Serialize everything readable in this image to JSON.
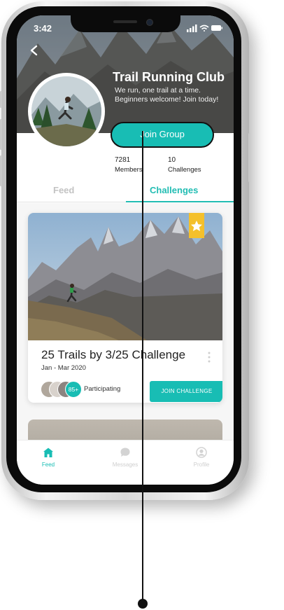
{
  "status_bar": {
    "time": "3:42"
  },
  "group": {
    "name": "Trail Running Club",
    "tagline_1": "We run, one trail at a time.",
    "tagline_2": "Beginners welcome! Join today!",
    "join_label": "Join Group",
    "stats": [
      {
        "value": "7281",
        "label": "Members"
      },
      {
        "value": "10",
        "label": "Challenges"
      }
    ]
  },
  "tabs": [
    {
      "label": "Feed",
      "active": false
    },
    {
      "label": "Challenges",
      "active": true
    }
  ],
  "challenge": {
    "title": "25 Trails by 3/25 Challenge",
    "dates": "Jan - Mar 2020",
    "participant_count": "85+",
    "participating_label": "Participating",
    "join_label": "JOIN CHALLENGE",
    "badge_icon": "star-icon"
  },
  "bottom_nav": [
    {
      "label": "Feed",
      "icon": "home-icon",
      "active": true
    },
    {
      "label": "Messages",
      "icon": "chat-icon",
      "active": false
    },
    {
      "label": "Profile",
      "icon": "user-icon",
      "active": false
    }
  ],
  "colors": {
    "accent": "#18bdb4",
    "badge": "#f4c02c",
    "inactive": "#c3c3c3"
  }
}
